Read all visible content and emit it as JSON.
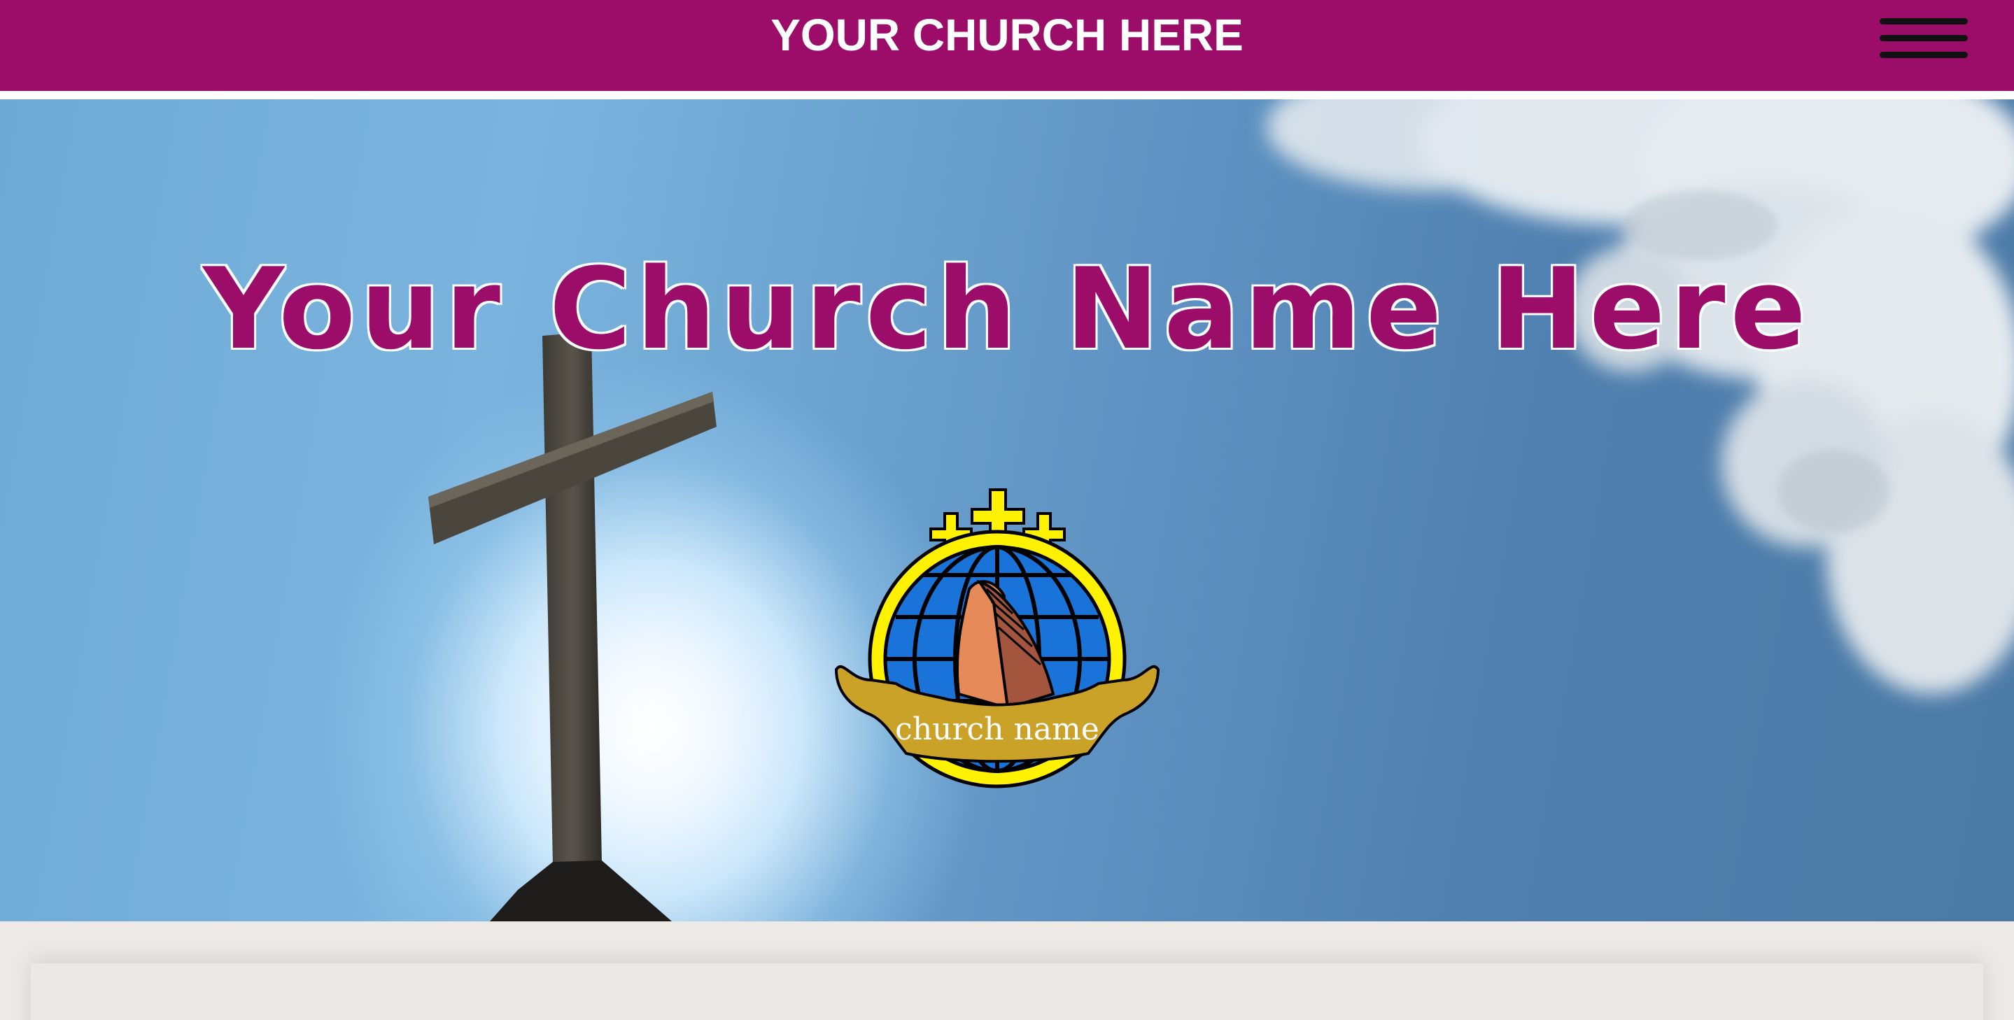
{
  "header": {
    "site_title": "YOUR CHURCH HERE",
    "menu_icon": "hamburger-menu-icon"
  },
  "hero": {
    "heading": "Your Church Name Here",
    "logo": {
      "caption": "church name",
      "icon": "praying-hands-globe-crosses-logo"
    }
  },
  "colors": {
    "brand": "#9b0d68",
    "header_text": "#ffffff",
    "lower_section": "#ece9e6",
    "logo_yellow": "#fff200",
    "logo_gold": "#c9a227",
    "logo_blue": "#1a73d9"
  }
}
